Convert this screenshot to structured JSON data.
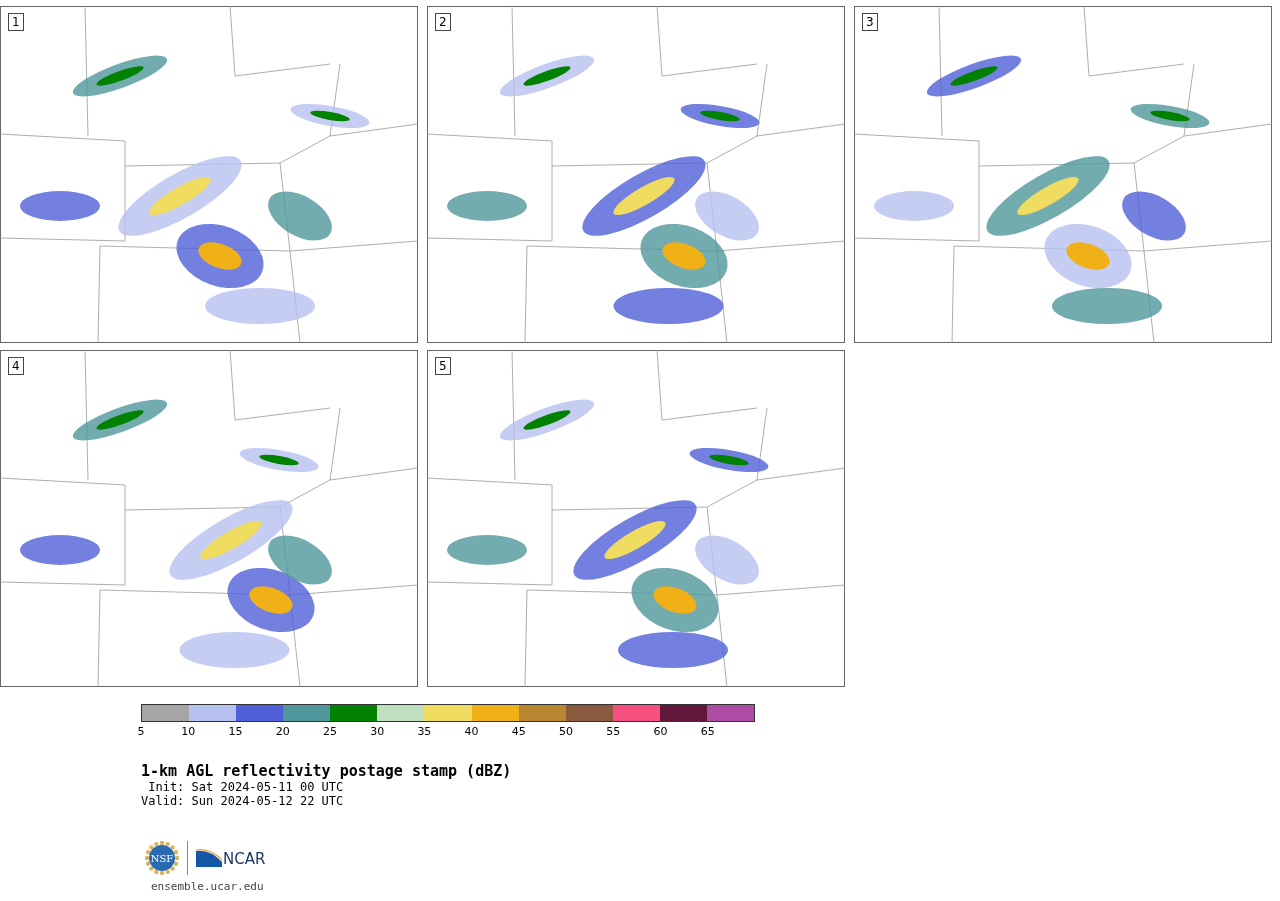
{
  "panels": [
    {
      "label": "1"
    },
    {
      "label": "2"
    },
    {
      "label": "3"
    },
    {
      "label": "4"
    },
    {
      "label": "5"
    }
  ],
  "colorbar": {
    "segments": [
      {
        "color": "#a5a5a5"
      },
      {
        "color": "#b7c1ef"
      },
      {
        "color": "#5060d8"
      },
      {
        "color": "#4f979b"
      },
      {
        "color": "#008200"
      },
      {
        "color": "#bfdfbf"
      },
      {
        "color": "#f0dc60"
      },
      {
        "color": "#f0b018"
      },
      {
        "color": "#b88530"
      },
      {
        "color": "#8a5a3e"
      },
      {
        "color": "#f44f7f"
      },
      {
        "color": "#60173a"
      },
      {
        "color": "#ac4ca4"
      }
    ],
    "ticks": [
      "5",
      "10",
      "15",
      "20",
      "25",
      "30",
      "35",
      "40",
      "45",
      "50",
      "55",
      "60",
      "65"
    ]
  },
  "title": "1-km AGL reflectivity postage stamp (dBZ)",
  "init": " Init: Sat 2024-05-11 00 UTC",
  "valid": "Valid: Sun 2024-05-12 22 UTC",
  "logos": {
    "nsf": "NSF",
    "ncar": "NCAR"
  },
  "url": "ensemble.ucar.edu"
}
